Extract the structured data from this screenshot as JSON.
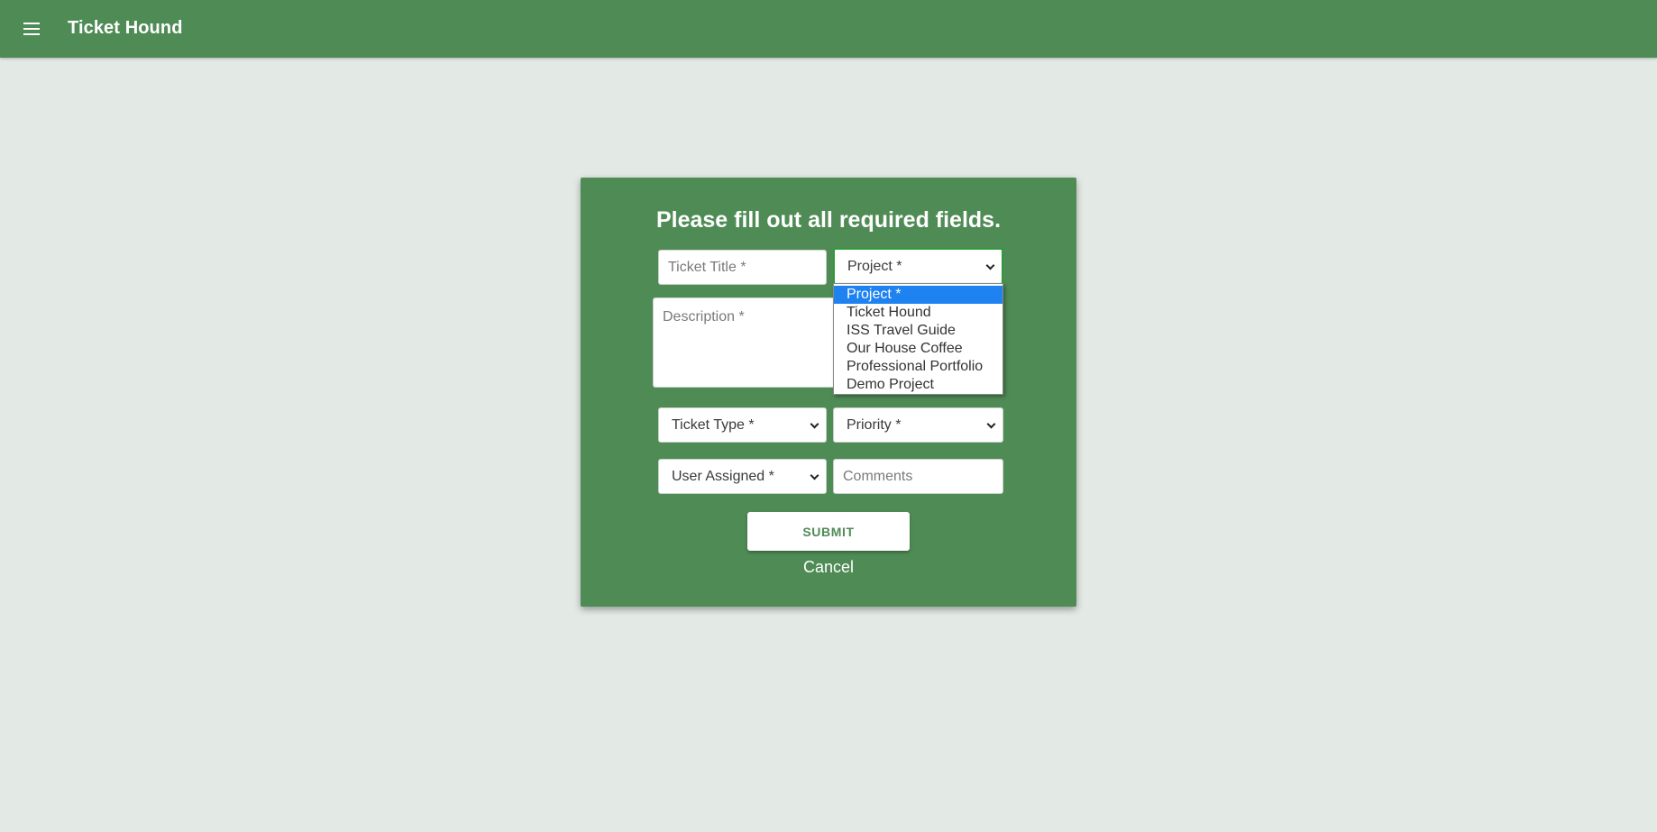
{
  "appbar": {
    "title": "Ticket Hound",
    "menu_icon": "hamburger-menu-icon"
  },
  "colors": {
    "primary": "#4f8b55",
    "background": "#e3e9e4",
    "option_highlight": "#1e82f0",
    "focus_border": "#2e9a3b"
  },
  "form": {
    "heading": "Please fill out all required fields.",
    "ticket_title": {
      "value": "",
      "placeholder": "Ticket Title *"
    },
    "project": {
      "selected": "Project *",
      "open": true,
      "options": [
        "Project *",
        "Ticket Hound",
        "ISS Travel Guide",
        "Our House Coffee",
        "Professional Portfolio",
        "Demo Project"
      ]
    },
    "description": {
      "value": "",
      "placeholder": "Description *"
    },
    "ticket_type": {
      "selected": "Ticket Type *"
    },
    "priority": {
      "selected": "Priority *"
    },
    "user_assigned": {
      "selected": "User Assigned *"
    },
    "comments": {
      "value": "",
      "placeholder": "Comments"
    },
    "submit_label": "SUBMIT",
    "cancel_label": "Cancel"
  }
}
